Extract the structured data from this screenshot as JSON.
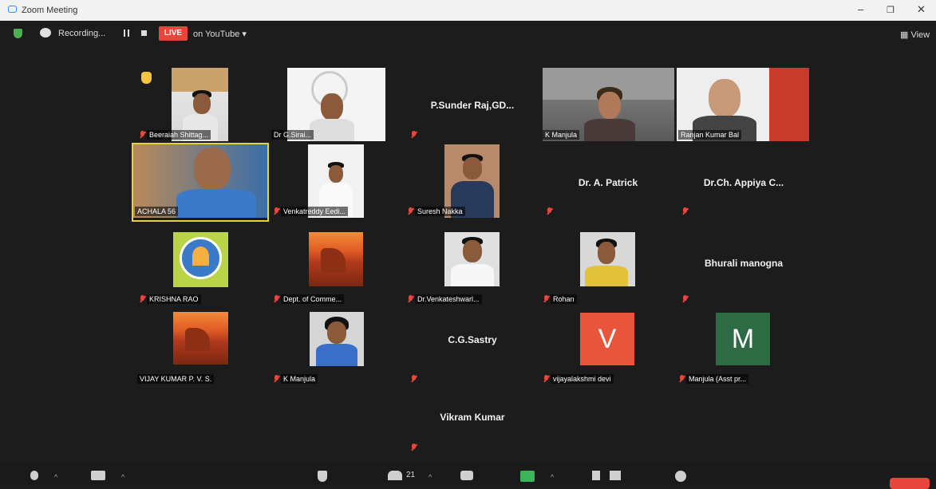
{
  "window": {
    "title": "Zoom Meeting"
  },
  "recording": {
    "label": "Recording...",
    "live_label": "LIVE",
    "stream_label": "on YouTube ▾"
  },
  "view_label": "View",
  "participants": [
    {
      "name": "Beeraiah Shittag..."
    },
    {
      "name": "Dr G.Sirai..."
    },
    {
      "name": "P.Sunder  Raj,GD..."
    },
    {
      "name": "K Manjula"
    },
    {
      "name": "Ranjan Kumar Bal"
    },
    {
      "name": "ACHALA 56"
    },
    {
      "name": "Venkatreddy Eedi..."
    },
    {
      "name": "Suresh Nakka"
    },
    {
      "name": "Dr. A. Patrick"
    },
    {
      "name": "Dr.Ch. Appiya C..."
    },
    {
      "name": "KRISHNA RAO"
    },
    {
      "name": "Dept. of Comme..."
    },
    {
      "name": "Dr.Venkateshwarl..."
    },
    {
      "name": "Rohan"
    },
    {
      "name": "Bhurali manogna"
    },
    {
      "name": "VIJAY KUMAR P. V. S."
    },
    {
      "name": "K Manjula"
    },
    {
      "name": "C.G.Sastry"
    },
    {
      "name": "vijayalakshmi devi",
      "initial": "V",
      "color": "#e8553a"
    },
    {
      "name": "Manjula (Asst pr...",
      "initial": "M",
      "color": "#2e6b45"
    },
    {
      "name": "Vikram Kumar"
    }
  ],
  "toolbar": {
    "participant_count": "21"
  },
  "colors": {
    "live": "#e8453c",
    "active_speaker": "#e3d33c",
    "muted_mic": "#e8453c"
  }
}
